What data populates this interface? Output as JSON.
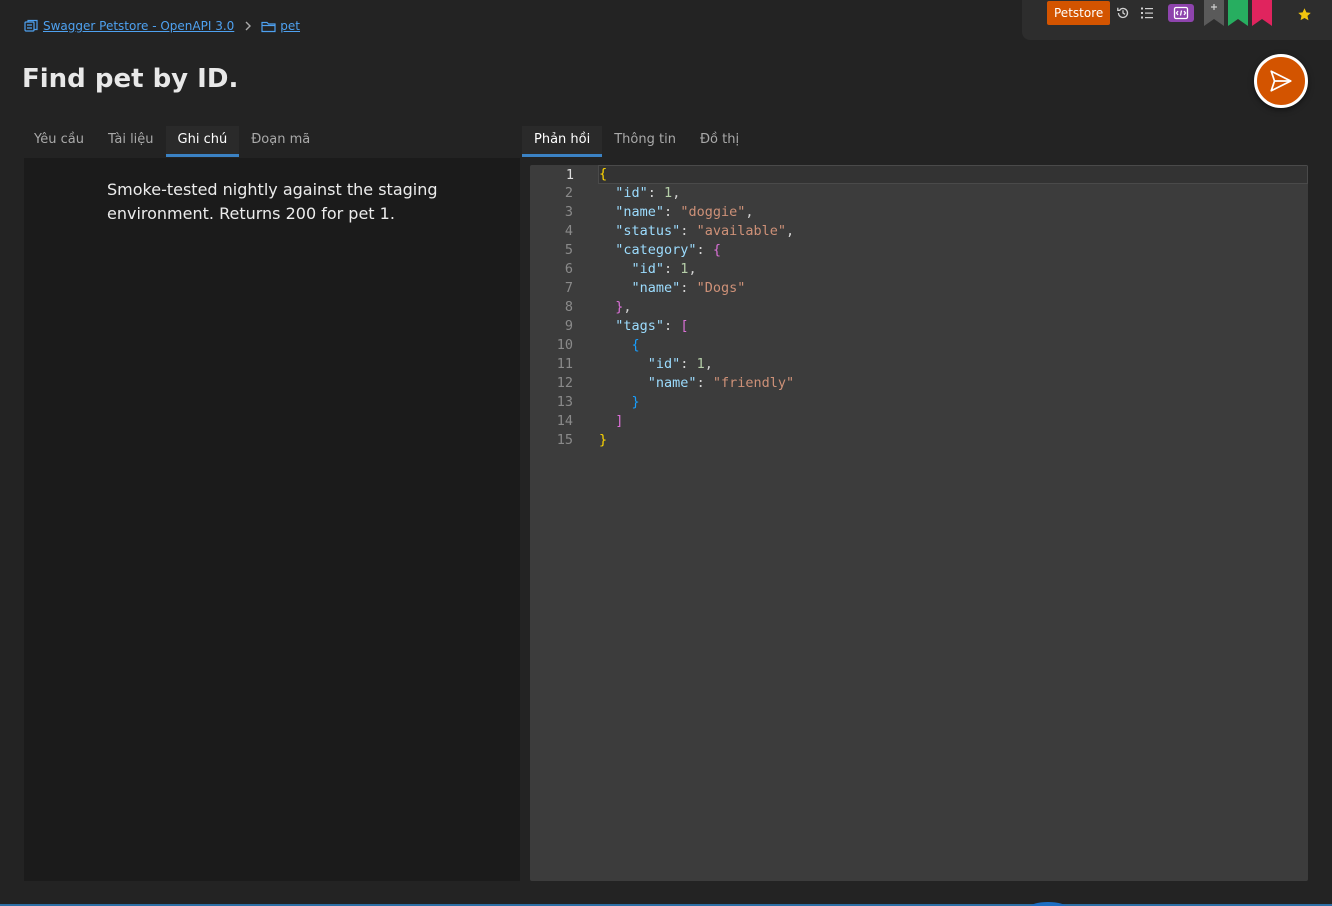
{
  "breadcrumb": {
    "collection": "Swagger Petstore - OpenAPI 3.0",
    "folder": "pet"
  },
  "toolbar": {
    "environment": "Petstore",
    "icons": [
      "history-icon",
      "list-icon",
      "code-panel-icon",
      "bookmark-add-icon",
      "bookmark-green-icon",
      "bookmark-pink-icon",
      "star-icon"
    ],
    "colors": {
      "environment": "#d35400",
      "code_panel": "#8e44ad",
      "bookmark_gray": "#5a5a5a",
      "bookmark_green": "#27ae60",
      "bookmark_pink": "#e0245e",
      "star": "#f1c40f"
    }
  },
  "page": {
    "title": "Find pet by ID."
  },
  "left_tabs": [
    {
      "label": "Yêu cầu",
      "active": false
    },
    {
      "label": "Tài liệu",
      "active": false
    },
    {
      "label": "Ghi chú",
      "active": true
    },
    {
      "label": "Đoạn mã",
      "active": false
    }
  ],
  "right_tabs": [
    {
      "label": "Phản hồi",
      "active": true
    },
    {
      "label": "Thông tin",
      "active": false
    },
    {
      "label": "Đồ thị",
      "active": false
    }
  ],
  "notes": {
    "text": "Smoke-tested nightly against the staging environment. Returns 200 for pet 1."
  },
  "response": {
    "lines": [
      {
        "n": "1",
        "tokens": [
          [
            "b1",
            "{"
          ]
        ]
      },
      {
        "n": "2",
        "tokens": [
          [
            "p",
            "  "
          ],
          [
            "k",
            "\"id\""
          ],
          [
            "p",
            ": "
          ],
          [
            "n",
            "1"
          ],
          [
            "p",
            ","
          ]
        ]
      },
      {
        "n": "3",
        "tokens": [
          [
            "p",
            "  "
          ],
          [
            "k",
            "\"name\""
          ],
          [
            "p",
            ": "
          ],
          [
            "s",
            "\"doggie\""
          ],
          [
            "p",
            ","
          ]
        ]
      },
      {
        "n": "4",
        "tokens": [
          [
            "p",
            "  "
          ],
          [
            "k",
            "\"status\""
          ],
          [
            "p",
            ": "
          ],
          [
            "s",
            "\"available\""
          ],
          [
            "p",
            ","
          ]
        ]
      },
      {
        "n": "5",
        "tokens": [
          [
            "p",
            "  "
          ],
          [
            "k",
            "\"category\""
          ],
          [
            "p",
            ": "
          ],
          [
            "b2",
            "{"
          ]
        ]
      },
      {
        "n": "6",
        "tokens": [
          [
            "p",
            "    "
          ],
          [
            "k",
            "\"id\""
          ],
          [
            "p",
            ": "
          ],
          [
            "n",
            "1"
          ],
          [
            "p",
            ","
          ]
        ]
      },
      {
        "n": "7",
        "tokens": [
          [
            "p",
            "    "
          ],
          [
            "k",
            "\"name\""
          ],
          [
            "p",
            ": "
          ],
          [
            "s",
            "\"Dogs\""
          ]
        ]
      },
      {
        "n": "8",
        "tokens": [
          [
            "p",
            "  "
          ],
          [
            "b2",
            "}"
          ],
          [
            "p",
            ","
          ]
        ]
      },
      {
        "n": "9",
        "tokens": [
          [
            "p",
            "  "
          ],
          [
            "k",
            "\"tags\""
          ],
          [
            "p",
            ": "
          ],
          [
            "b2",
            "["
          ]
        ]
      },
      {
        "n": "10",
        "tokens": [
          [
            "p",
            "    "
          ],
          [
            "b3",
            "{"
          ]
        ]
      },
      {
        "n": "11",
        "tokens": [
          [
            "p",
            "      "
          ],
          [
            "k",
            "\"id\""
          ],
          [
            "p",
            ": "
          ],
          [
            "n",
            "1"
          ],
          [
            "p",
            ","
          ]
        ]
      },
      {
        "n": "12",
        "tokens": [
          [
            "p",
            "      "
          ],
          [
            "k",
            "\"name\""
          ],
          [
            "p",
            ": "
          ],
          [
            "s",
            "\"friendly\""
          ]
        ]
      },
      {
        "n": "13",
        "tokens": [
          [
            "p",
            "    "
          ],
          [
            "b3",
            "}"
          ]
        ]
      },
      {
        "n": "14",
        "tokens": [
          [
            "p",
            "  "
          ],
          [
            "b2",
            "]"
          ]
        ]
      },
      {
        "n": "15",
        "tokens": [
          [
            "b1",
            "}"
          ]
        ]
      }
    ]
  }
}
